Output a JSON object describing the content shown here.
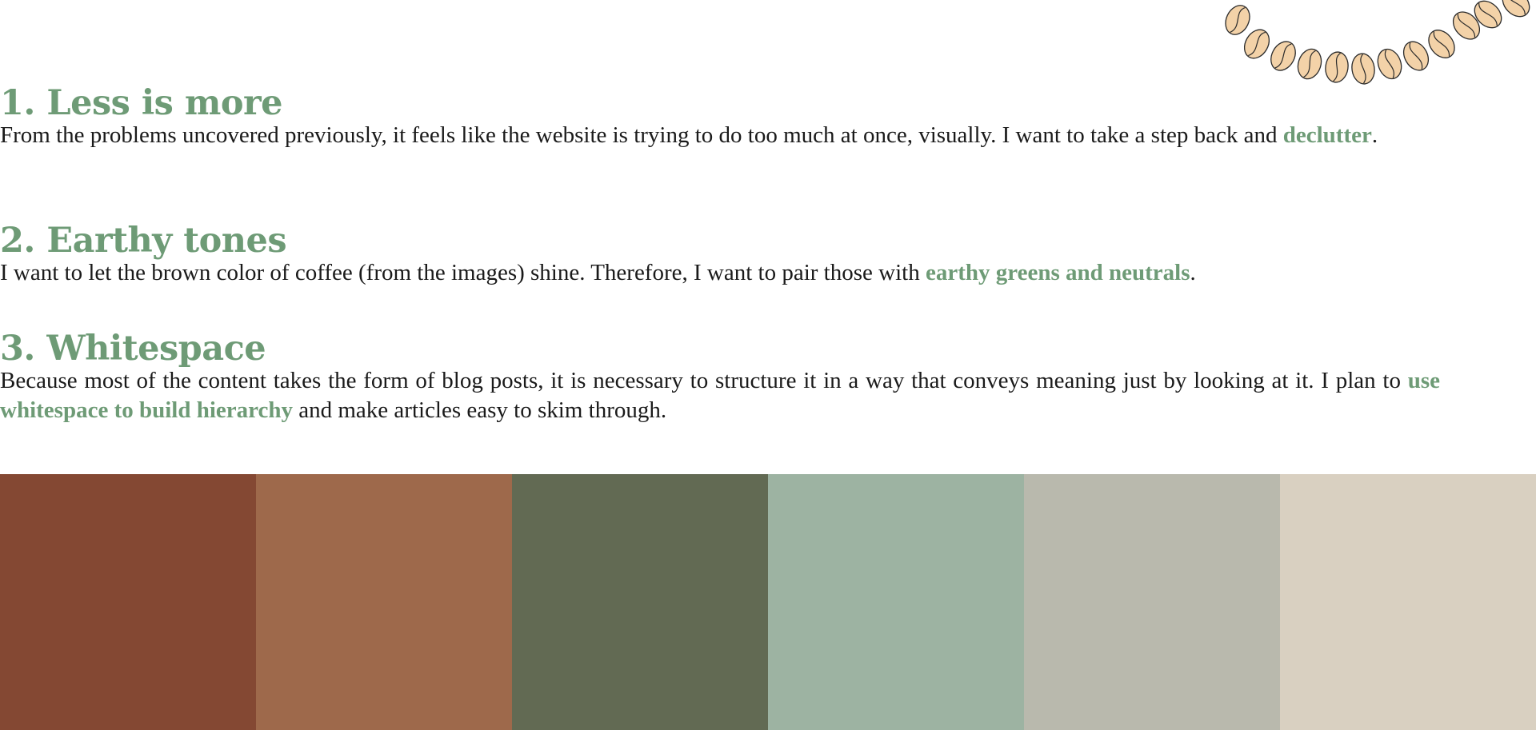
{
  "theme": {
    "accent": "#6e9b76",
    "text": "#1a1a1a",
    "bean_fill": "#f3d2a8",
    "bean_stroke": "#2a2a2a"
  },
  "sections": [
    {
      "heading": "1. Less is more",
      "before": "From the problems uncovered previously, it feels like the website is trying to do too much at once, visually. I want to take a step back and ",
      "highlight": "declutter",
      "after": "."
    },
    {
      "heading": "2. Earthy tones",
      "before": "I want to let the brown color of coffee (from the images) shine. Therefore, I want to pair those with ",
      "highlight": "earthy greens and neutrals",
      "after": "."
    },
    {
      "heading": "3. Whitespace",
      "before": "Because most of the content takes the form of blog posts, it is necessary to structure it in a way that conveys meaning just by looking at it. I plan to ",
      "highlight": "use whitespace to build hierarchy",
      "after": " and make articles easy to skim through."
    }
  ],
  "decoration": {
    "icon": "coffee-bean-garland-icon",
    "bean_count": 12
  },
  "palette": [
    {
      "name": "swatch-1",
      "color": "#844833"
    },
    {
      "name": "swatch-2",
      "color": "#9e694b"
    },
    {
      "name": "swatch-3",
      "color": "#626a53"
    },
    {
      "name": "swatch-4",
      "color": "#9db3a2"
    },
    {
      "name": "swatch-5",
      "color": "#b9b9ad"
    },
    {
      "name": "swatch-6",
      "color": "#d9d0c1"
    }
  ]
}
